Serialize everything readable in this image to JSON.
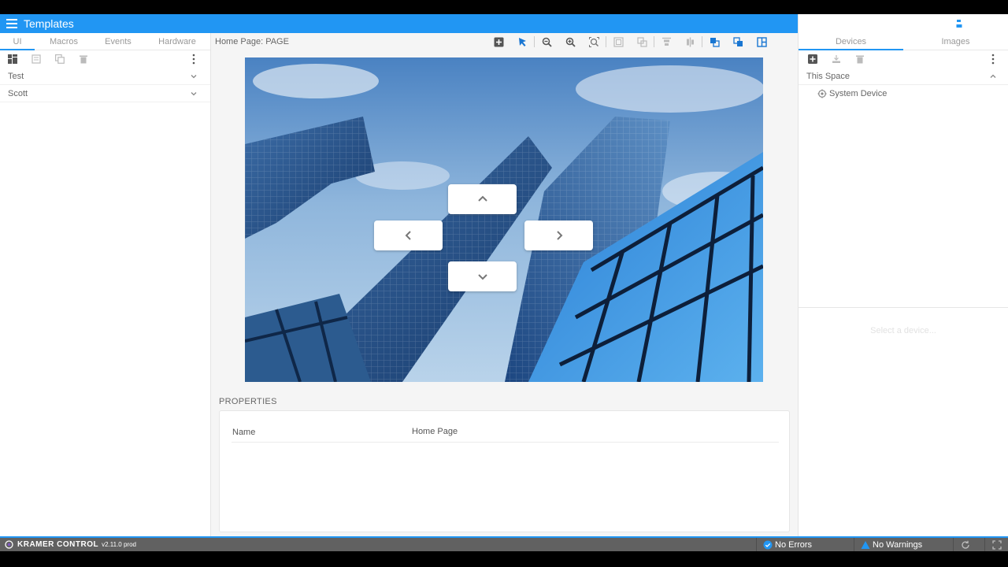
{
  "app": {
    "title": "Templates"
  },
  "topbar_icons": [
    "building-icon",
    "left-panel-icon",
    "bottom-panel-icon",
    "right-panel-icon",
    "export-icon",
    "download-icon",
    "save-icon"
  ],
  "left_panel": {
    "tabs": [
      {
        "label": "UI",
        "active": true
      },
      {
        "label": "Macros",
        "active": false
      },
      {
        "label": "Events",
        "active": false
      },
      {
        "label": "Hardware",
        "active": false
      }
    ],
    "tools": [
      "add-page-icon",
      "document-icon",
      "copy-icon",
      "trash-icon",
      "more-vert-icon"
    ],
    "items": [
      {
        "label": "Test"
      },
      {
        "label": "Scott"
      }
    ]
  },
  "center": {
    "page_label": "Home Page: PAGE",
    "tools": [
      "add-icon",
      "pointer-icon",
      "zoom-out-icon",
      "zoom-in-icon",
      "zoom-fit-icon",
      "group-icon",
      "ungroup-icon",
      "align-top-icon",
      "align-middle-icon",
      "bring-front-icon",
      "send-back-icon",
      "layout-icon"
    ],
    "nav_buttons": [
      "chevron-up-icon",
      "chevron-left-icon",
      "chevron-right-icon",
      "chevron-down-icon"
    ],
    "properties": {
      "title": "PROPERTIES",
      "rows": [
        {
          "key": "Name",
          "value": "Home Page"
        }
      ]
    }
  },
  "right_panel": {
    "tabs": [
      {
        "label": "Devices",
        "active": true
      },
      {
        "label": "Images",
        "active": false
      }
    ],
    "space": {
      "label": "This Space"
    },
    "devices": [
      {
        "label": "System Device"
      }
    ],
    "hint": "Select a device..."
  },
  "status_bar": {
    "brand": "KRAMER CONTROL",
    "version": "v2.11.0 prod",
    "errors": "No Errors",
    "warnings": "No Warnings"
  },
  "colors": {
    "accent": "#2196f3",
    "status_bar": "#616161",
    "panel_bg": "#ffffff",
    "workspace_bg": "#f5f5f5"
  }
}
